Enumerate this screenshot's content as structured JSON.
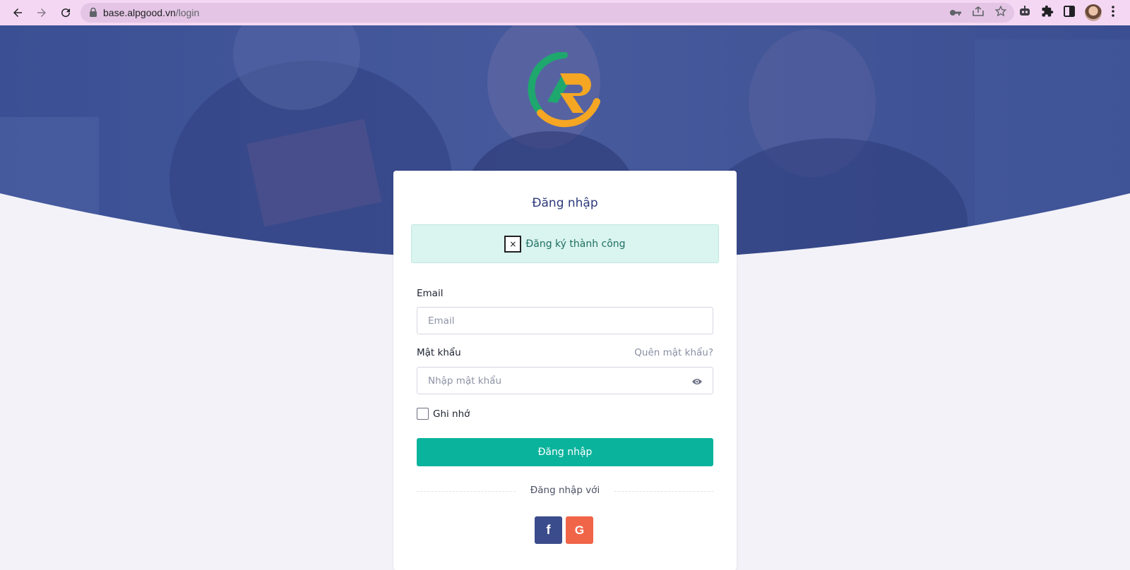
{
  "browser": {
    "url_host": "base.alpgood.vn",
    "url_path": "/login",
    "icons": [
      "back-icon",
      "forward-icon",
      "reload-icon",
      "lock-icon",
      "key-icon",
      "share-icon",
      "star-icon",
      "robot-icon",
      "extensions-icon",
      "sidepanel-icon",
      "avatar",
      "menu-icon"
    ]
  },
  "colors": {
    "primary": "#0ab39c",
    "title": "#2d3a7a",
    "hero_overlay": "#3c4f96",
    "facebook": "#3b4c8c",
    "google": "#f06548"
  },
  "login": {
    "title": "Đăng nhập",
    "alert": {
      "close": "×",
      "message": "Đăng ký thành công"
    },
    "email_label": "Email",
    "email_placeholder": "Email",
    "password_label": "Mật khẩu",
    "forgot_link": "Quên mật khẩu?",
    "password_placeholder": "Nhập mật khẩu",
    "remember_label": "Ghi nhớ",
    "submit_label": "Đăng nhập",
    "divider_text": "Đăng nhập với",
    "social": {
      "facebook_label": "f",
      "google_label": "G"
    }
  }
}
